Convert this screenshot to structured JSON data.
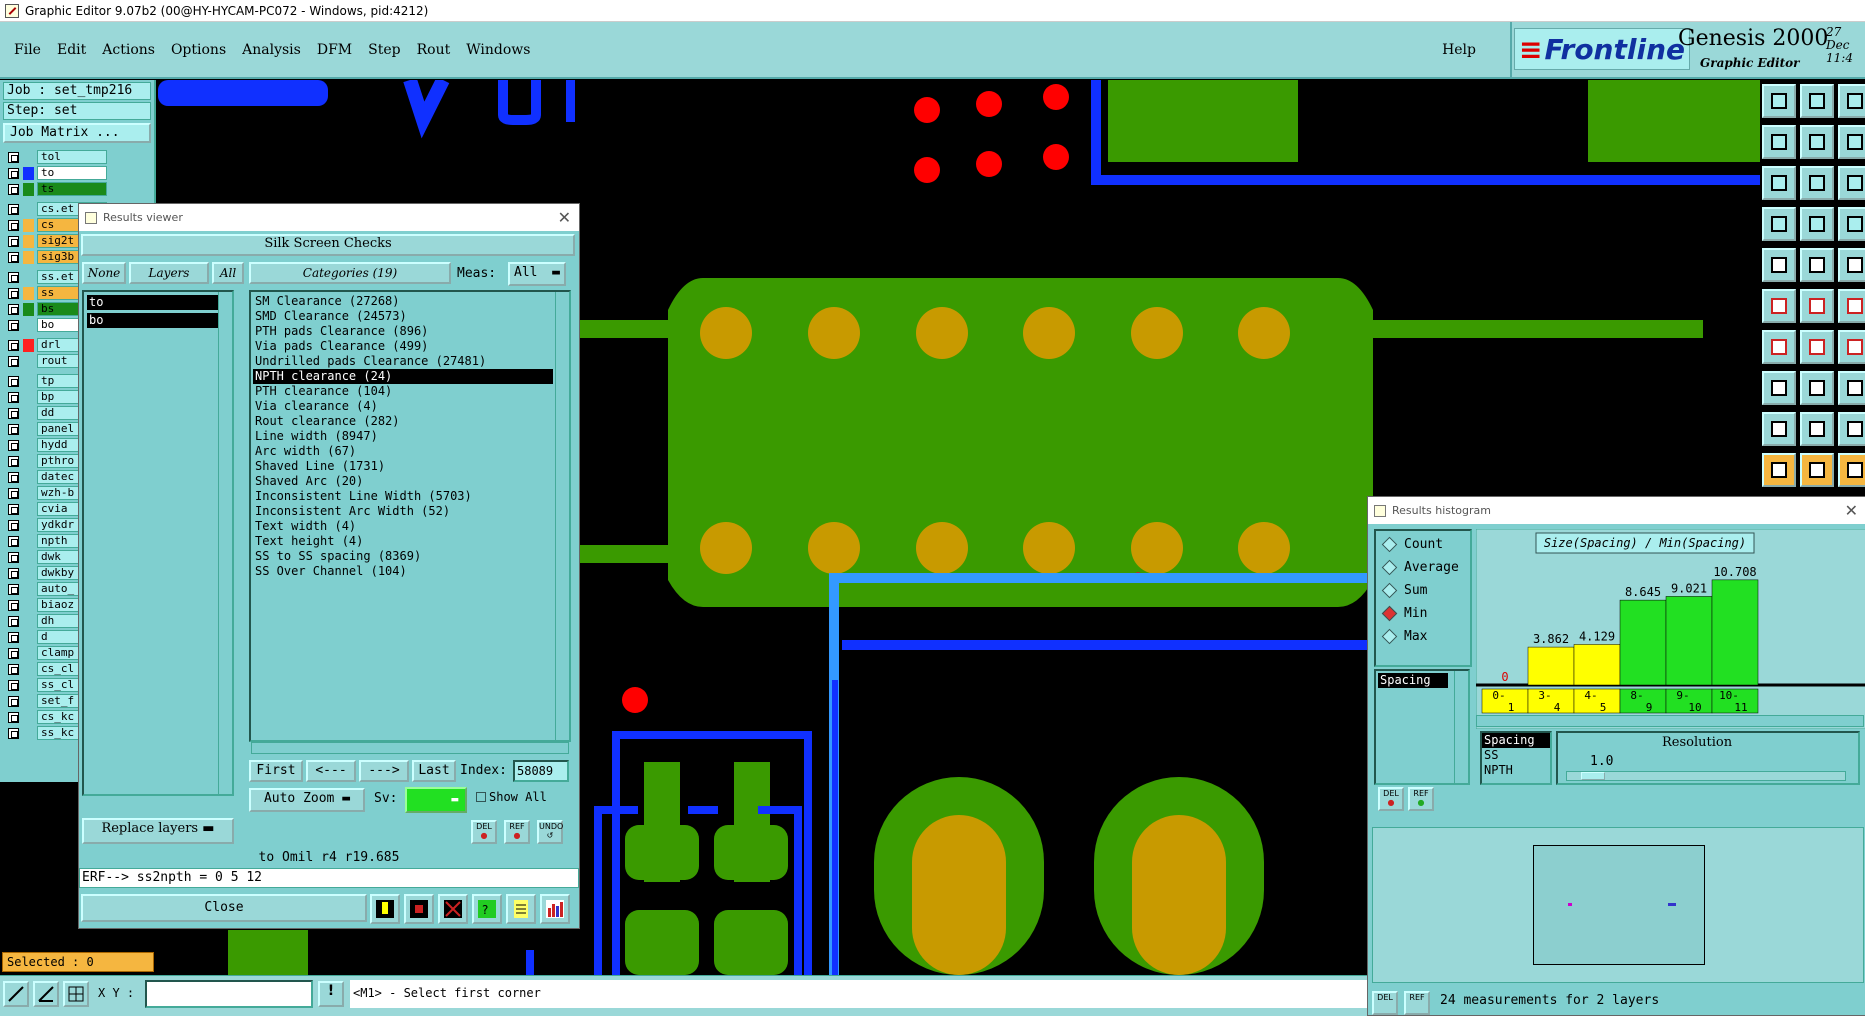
{
  "title_bar": {
    "text": "Graphic Editor 9.07b2 (00@HY-HYCAM-PC072 - Windows, pid:4212)"
  },
  "menu": {
    "items": [
      "File",
      "Edit",
      "Actions",
      "Options",
      "Analysis",
      "DFM",
      "Step",
      "Rout",
      "Windows"
    ],
    "help": "Help"
  },
  "brand": {
    "logo": "Frontline",
    "product": "Genesis 2000",
    "subtitle": "Graphic Editor",
    "date": "27 Dec",
    "time": "11:4"
  },
  "left_panel": {
    "job": "Job : set_tmp216",
    "step": "Step: set",
    "job_matrix": "Job Matrix ...",
    "layers": [
      {
        "name": "tol",
        "color": "#7fcfcf"
      },
      {
        "name": "to",
        "color": "#1030ff"
      },
      {
        "name": "ts",
        "color": "#1a8a1a"
      },
      {
        "name": "cs.et",
        "color": "#7fcfcf"
      },
      {
        "name": "cs",
        "color": "#f5b640"
      },
      {
        "name": "sig2t",
        "color": "#f5b640"
      },
      {
        "name": "sig3b",
        "color": "#f5b640"
      },
      {
        "name": "ss.et",
        "color": "#7fcfcf"
      },
      {
        "name": "ss",
        "color": "#f5b640"
      },
      {
        "name": "bs",
        "color": "#1a8a1a"
      },
      {
        "name": "bo",
        "color": "#7fcfcf"
      },
      {
        "name": "drl",
        "color": "#ff2020"
      },
      {
        "name": "rout",
        "color": "#7fcfcf"
      },
      {
        "name": "tp",
        "color": "#7fcfcf"
      },
      {
        "name": "bp",
        "color": "#7fcfcf"
      },
      {
        "name": "dd",
        "color": "#7fcfcf"
      },
      {
        "name": "panel",
        "color": "#7fcfcf"
      },
      {
        "name": "hydd",
        "color": "#7fcfcf"
      },
      {
        "name": "pthro",
        "color": "#7fcfcf"
      },
      {
        "name": "datec",
        "color": "#7fcfcf"
      },
      {
        "name": "wzh-b",
        "color": "#7fcfcf"
      },
      {
        "name": "cvia",
        "color": "#7fcfcf"
      },
      {
        "name": "ydkdr",
        "color": "#7fcfcf"
      },
      {
        "name": "npth",
        "color": "#7fcfcf"
      },
      {
        "name": "dwk",
        "color": "#7fcfcf"
      },
      {
        "name": "dwkby",
        "color": "#7fcfcf"
      },
      {
        "name": "auto_",
        "color": "#7fcfcf"
      },
      {
        "name": "biaoz",
        "color": "#7fcfcf"
      },
      {
        "name": "dh",
        "color": "#7fcfcf"
      },
      {
        "name": "d",
        "color": "#7fcfcf"
      },
      {
        "name": "clamp",
        "color": "#7fcfcf"
      },
      {
        "name": "cs_cl",
        "color": "#7fcfcf"
      },
      {
        "name": "ss_cl",
        "color": "#7fcfcf"
      },
      {
        "name": "set_f",
        "color": "#7fcfcf"
      },
      {
        "name": "cs_kc",
        "color": "#7fcfcf"
      },
      {
        "name": "ss_kc",
        "color": "#7fcfcf"
      }
    ],
    "selected": "Selected : 0"
  },
  "results_viewer": {
    "window_title": "Results viewer",
    "header": "Silk Screen Checks",
    "btn_none": "None",
    "btn_layers": "Layers",
    "btn_all": "All",
    "categories_label": "Categories (19)",
    "meas_label": "Meas:",
    "meas_value": "All",
    "layers": [
      "to",
      "bo"
    ],
    "categories": [
      "SM Clearance (27268)",
      "SMD Clearance (24573)",
      "PTH pads Clearance (896)",
      "Via pads Clearance (499)",
      "Undrilled pads Clearance (27481)",
      "NPTH clearance (24)",
      "PTH clearance (104)",
      "Via clearance (4)",
      "Rout clearance (282)",
      "Line width (8947)",
      "Arc width (67)",
      "Shaved Line (1731)",
      "Shaved Arc (20)",
      "Inconsistent Line Width (5703)",
      "Inconsistent Arc Width (52)",
      "Text width (4)",
      "Text height (4)",
      "SS to SS spacing (8369)",
      "SS Over Channel (104)"
    ],
    "selected_category": 5,
    "nav": {
      "first": "First",
      "prev": "<---",
      "next": "--->",
      "last": "Last",
      "index_label": "Index:",
      "index_value": "58089"
    },
    "auto_zoom": "Auto Zoom",
    "sv_label": "Sv:",
    "show_all": "Show All",
    "replace_layers": "Replace layers",
    "del": "DEL",
    "ref": "REF",
    "undo": "UNDO",
    "info_line": "to Omil   r4   r19.685",
    "erf_line": "ERF--> ss2npth = 0 5 12",
    "close": "Close"
  },
  "histogram": {
    "window_title": "Results histogram",
    "options": [
      "Count",
      "Average",
      "Sum",
      "Min",
      "Max"
    ],
    "selected_option": "Min",
    "list_item": "Spacing",
    "title": "Size(Spacing) / Min(Spacing)",
    "lower_list": [
      "Spacing",
      "SS",
      "NPTH"
    ],
    "resolution_label": "Resolution",
    "resolution_value": "1.0",
    "status": "24 measurements for 2 layers",
    "del": "DEL",
    "ref": "REF"
  },
  "chart_data": {
    "type": "bar",
    "title": "Size(Spacing) / Min(Spacing)",
    "categories": [
      "0-1",
      "3-4",
      "4-5",
      "8-9",
      "9-10",
      "10-11"
    ],
    "values": [
      0,
      3.862,
      4.129,
      8.645,
      9.021,
      10.708
    ],
    "value_labels": [
      "0",
      "3.862",
      "4.129",
      "8.645",
      "9.021",
      "10.708"
    ],
    "colors": [
      "#ffff00",
      "#ffff00",
      "#ffff00",
      "#22e022",
      "#22e022",
      "#22e022"
    ],
    "ylim": [
      0,
      11
    ]
  },
  "status_bar": {
    "xy_label": "X Y :",
    "xy_value": "",
    "prompt": "<M1> - Select first corner"
  },
  "colors": {
    "panel": "#7fcfcf",
    "menu": "#9ad8d8",
    "copper": "#3a9a00",
    "pad": "#c89a00",
    "trace": "#1030ff",
    "drill": "#ff0000"
  }
}
